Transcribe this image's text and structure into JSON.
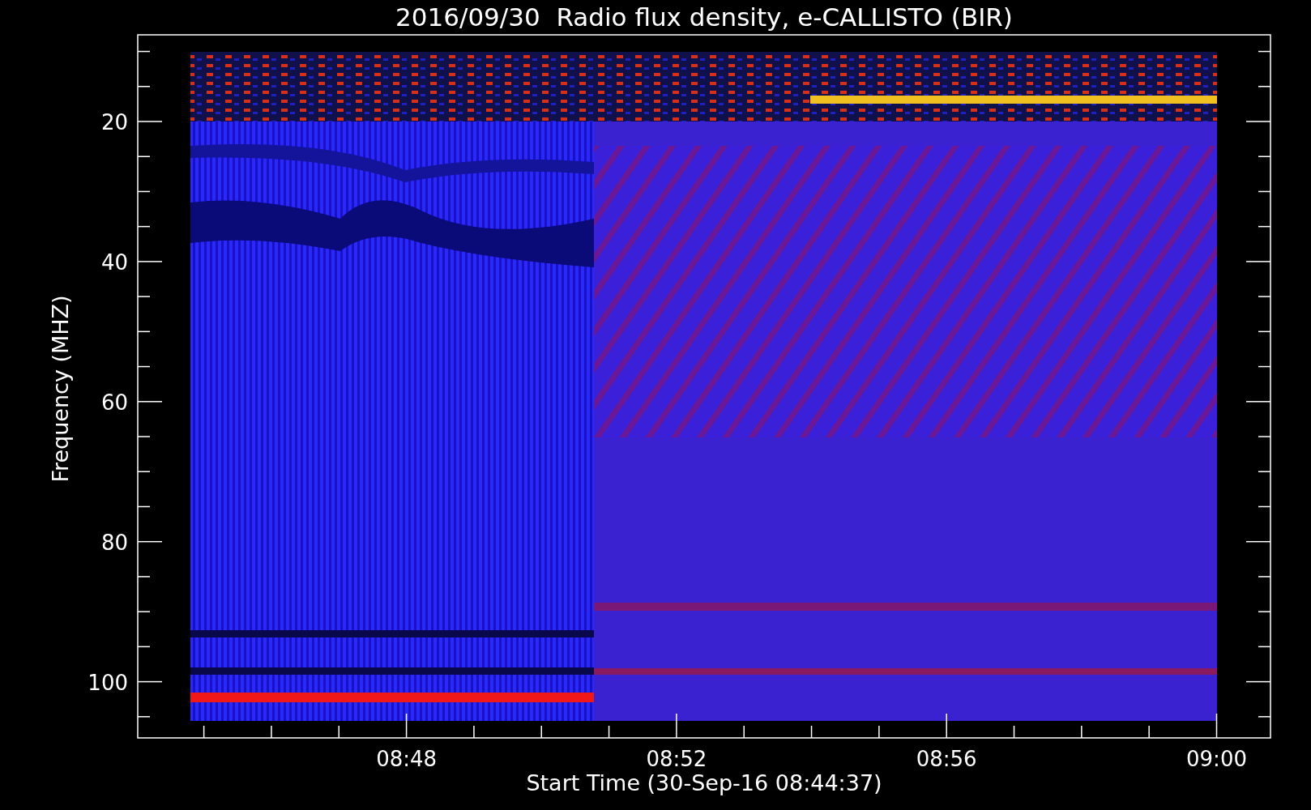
{
  "title": "2016/09/30  Radio flux density, e-CALLISTO (BIR)",
  "ylabel": "Frequency (MHZ)",
  "xlabel": "Start Time (30-Sep-16 08:44:37)",
  "yticks": [
    "20",
    "40",
    "60",
    "80",
    "100"
  ],
  "xticks": [
    "08:48",
    "08:52",
    "08:56",
    "09:00"
  ]
}
